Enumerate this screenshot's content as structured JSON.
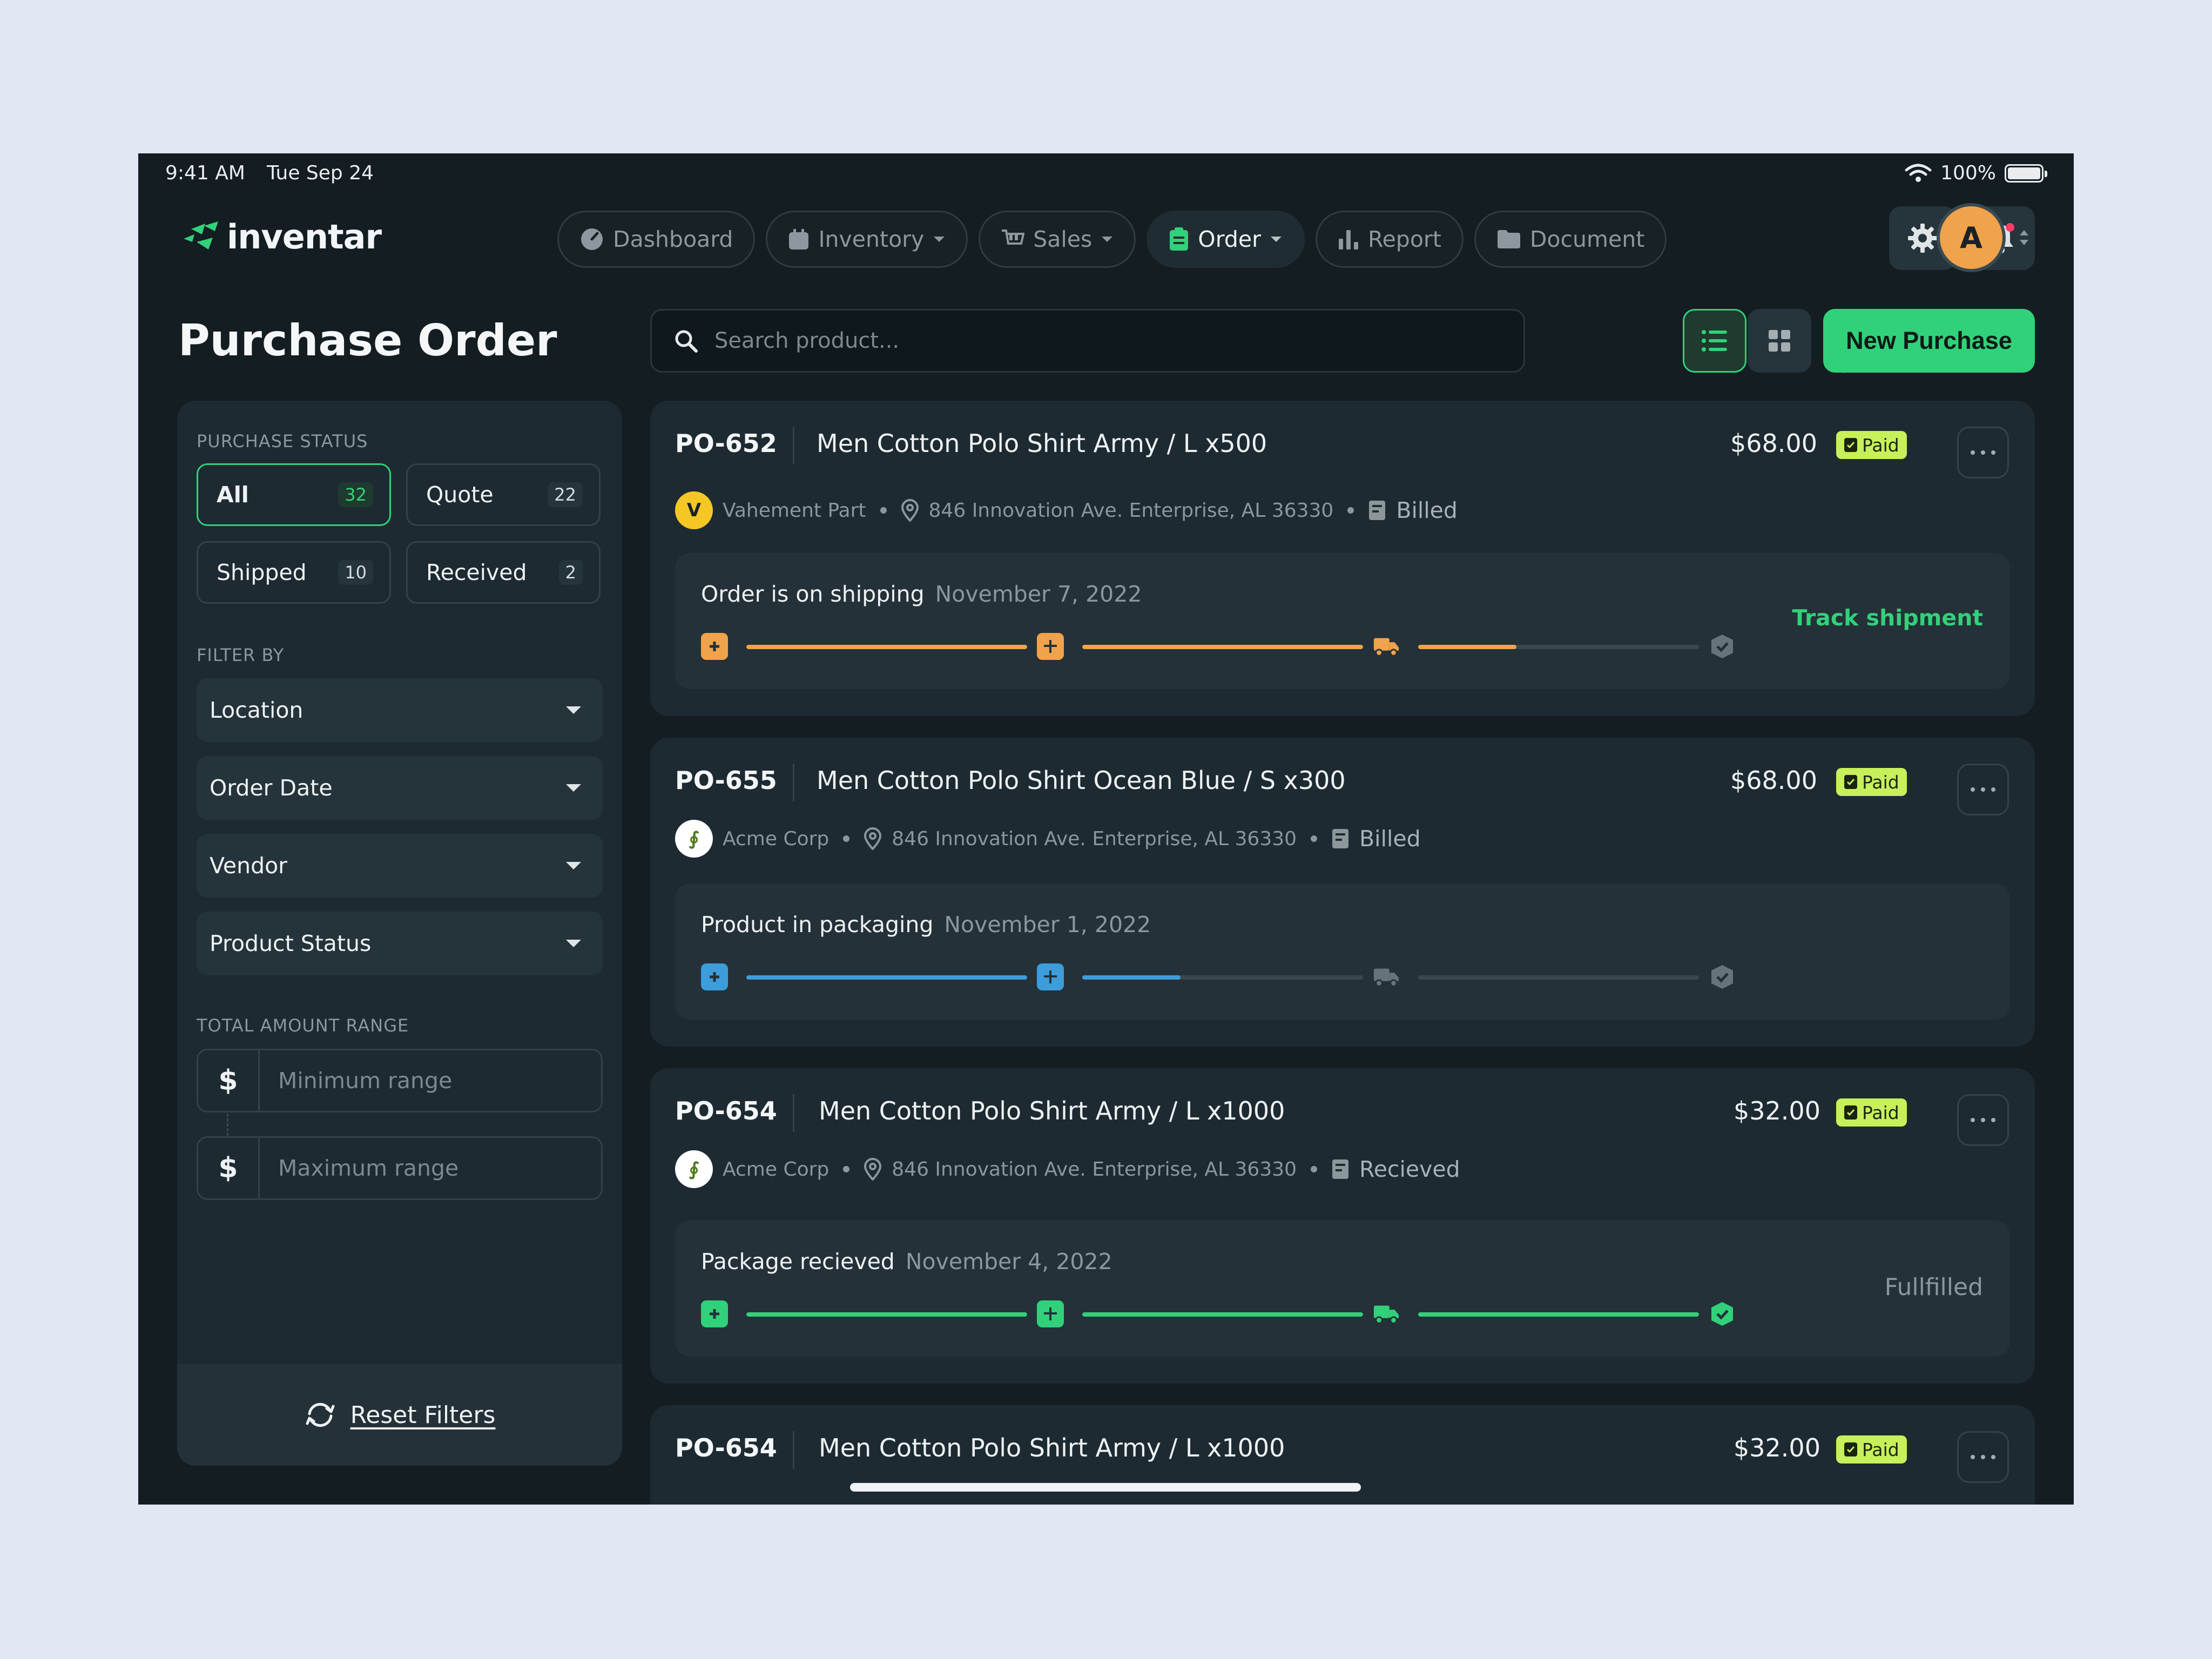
{
  "status_bar": {
    "time": "9:41 AM",
    "date": "Tue Sep 24",
    "battery": "100%"
  },
  "brand": {
    "name": "inventar",
    "accent": "#31d17a"
  },
  "nav": [
    {
      "label": "Dashboard",
      "icon": "gauge-icon"
    },
    {
      "label": "Inventory",
      "icon": "box-icon"
    },
    {
      "label": "Sales",
      "icon": "cart-icon"
    },
    {
      "label": "Order",
      "icon": "clipboard-icon"
    },
    {
      "label": "Report",
      "icon": "bar-chart-icon"
    },
    {
      "label": "Document",
      "icon": "folder-icon"
    }
  ],
  "user": {
    "initial": "A"
  },
  "page": {
    "title": "Purchase Order"
  },
  "toolbar": {
    "search_placeholder": "Search product...",
    "new_button": "New Purchase"
  },
  "sidebar": {
    "status_label": "PURCHASE STATUS",
    "statuses": [
      {
        "label": "All",
        "count": "32"
      },
      {
        "label": "Quote",
        "count": "22"
      },
      {
        "label": "Shipped",
        "count": "10"
      },
      {
        "label": "Received",
        "count": "2"
      }
    ],
    "filter_label": "FILTER BY",
    "filters": [
      "Location",
      "Order Date",
      "Vendor",
      "Product Status"
    ],
    "range_label": "TOTAL AMOUNT RANGE",
    "currency": "$",
    "min_placeholder": "Minimum range",
    "max_placeholder": "Maximum range",
    "reset": "Reset Filters"
  },
  "orders": [
    {
      "id": "PO-652",
      "product": "Men Cotton Polo Shirt Army / L x500",
      "price": "$68.00",
      "payment": "Paid",
      "vendor": "Vahement Part",
      "vendor_initial": "V",
      "address": "846 Innovation Ave. Enterprise, AL 36330",
      "state": "Billed",
      "track_title": "Order is on shipping",
      "track_date": "November 7, 2022",
      "action": "Track shipment",
      "progress": [
        1,
        1,
        0.35
      ],
      "color": "#f0a34a"
    },
    {
      "id": "PO-655",
      "product": "Men Cotton Polo Shirt Ocean Blue / S x300",
      "price": "$68.00",
      "payment": "Paid",
      "vendor": "Acme Corp",
      "vendor_initial": "∮",
      "address": "846 Innovation Ave. Enterprise, AL 36330",
      "state": "Billed",
      "track_title": "Product in packaging",
      "track_date": "November 1, 2022",
      "progress": [
        1,
        0.35,
        0
      ],
      "color": "#3d9ddb"
    },
    {
      "id": "PO-654",
      "product": "Men Cotton Polo Shirt Army / L x1000",
      "price": "$32.00",
      "payment": "Paid",
      "vendor": "Acme Corp",
      "vendor_initial": "∮",
      "address": "846 Innovation Ave. Enterprise, AL 36330",
      "state": "Recieved",
      "track_title": "Package recieved",
      "track_date": "November 4, 2022",
      "status_text": "Fullfilled",
      "progress": [
        1,
        1,
        1
      ],
      "color": "#31d17a"
    },
    {
      "id": "PO-654",
      "product": "Men Cotton Polo Shirt Army / L x1000",
      "price": "$32.00",
      "payment": "Paid"
    }
  ]
}
